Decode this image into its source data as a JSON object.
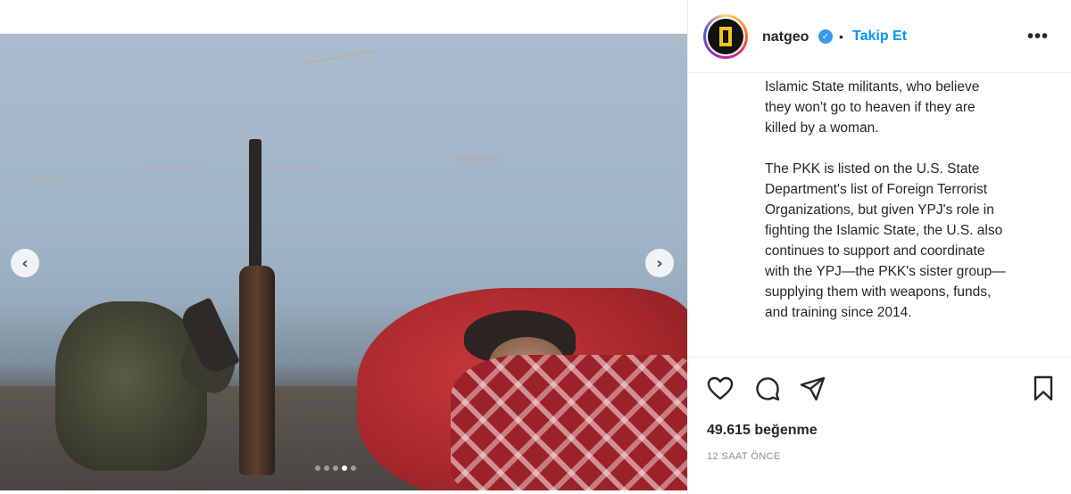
{
  "post": {
    "username": "natgeo",
    "follow_label": "Takip Et",
    "more_label": "•••",
    "verified_label": "✓",
    "separator": "•",
    "caption_paragraphs": [
      "Islamic State militants, who believe\nthey won't go to heaven if they are\nkilled by a woman.",
      "The PKK is listed on the U.S. State\nDepartment's list of Foreign Terrorist\nOrganizations, but given YPJ's role in\nfighting the Islamic State, the U.S. also\ncontinues to support and coordinate\nwith the YPJ—the PKK's sister group—\nsupplying them with weapons, funds,\nand training since 2014."
    ],
    "likes": "49.615 beğenme",
    "time": "12 SAAT ÖNCE"
  },
  "carousel": {
    "prev_icon": "‹",
    "next_icon": "›",
    "slide_count": 5,
    "active_slide": 4
  },
  "icons": {
    "like": "heart-icon",
    "comment": "comment-icon",
    "share": "share-icon",
    "save": "bookmark-icon"
  },
  "colors": {
    "accent": "#0095f6",
    "verified": "#3897f0",
    "text": "#262626",
    "muted": "#8e8e8e"
  }
}
